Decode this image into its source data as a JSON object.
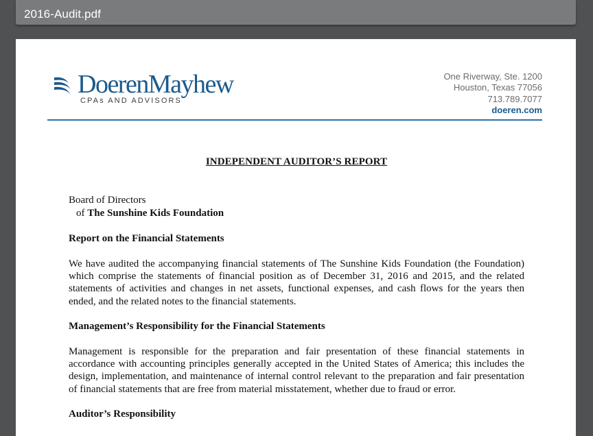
{
  "window": {
    "title": "2016-Audit.pdf"
  },
  "letterhead": {
    "logo_text": "DoerenMayhew",
    "logo_tagline": "CPAs AND ADVISORS",
    "address_line1": "One Riverway, Ste. 1200",
    "address_line2": "Houston, Texas 77056",
    "phone": "713.789.7077",
    "website": "doeren.com"
  },
  "colors": {
    "brand_blue": "#1c5a8d",
    "rule_blue": "#2f6fa3",
    "titlebar": "#7a7b7d",
    "background": "#505153"
  },
  "document": {
    "report_title": "INDEPENDENT AUDITOR’S REPORT",
    "addressee_line1": "Board of Directors",
    "addressee_prefix": "of ",
    "addressee_org": "The Sunshine Kids Foundation",
    "section1_heading": "Report on the Financial Statements",
    "section1_paragraph": "We have audited the accompanying financial statements of The Sunshine Kids Foundation (the Foundation) which comprise the statements of financial position as of December 31, 2016 and 2015, and the related statements of activities and changes in net assets, functional expenses, and cash flows for the years then ended, and the related notes to the financial statements.",
    "section2_heading": "Management’s Responsibility for the Financial Statements",
    "section2_paragraph": "Management is responsible for the preparation and fair presentation of these financial statements in accordance with accounting principles generally accepted in the United States of America; this includes the design, implementation, and maintenance of internal control relevant to the preparation and fair presentation of financial statements that are free from material misstatement, whether due to fraud or error.",
    "section3_heading": "Auditor’s Responsibility"
  }
}
